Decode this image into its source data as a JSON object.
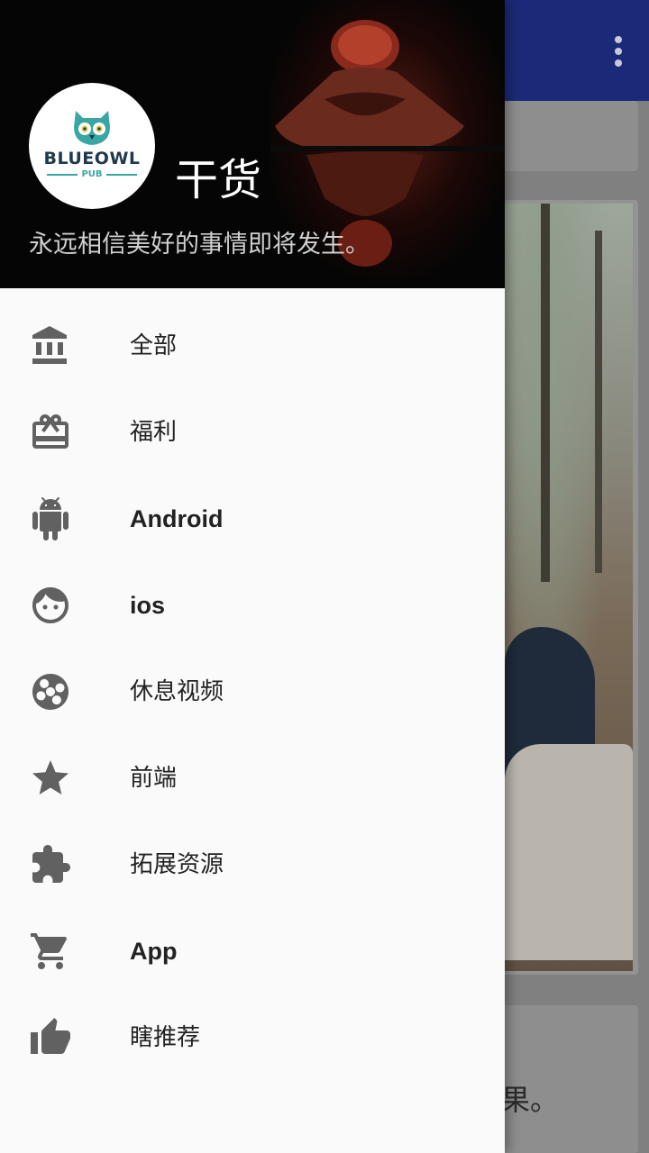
{
  "header": {
    "avatar_brand": "BLUEOWL",
    "avatar_sub": "PUB",
    "title": "干货",
    "subtitle": "永远相信美好的事情即将发生。"
  },
  "menu": {
    "items": [
      {
        "label": "全部",
        "icon": "bank-icon"
      },
      {
        "label": "福利",
        "icon": "gift-card-icon"
      },
      {
        "label": "Android",
        "icon": "android-icon"
      },
      {
        "label": "ios",
        "icon": "face-icon"
      },
      {
        "label": "休息视频",
        "icon": "film-reel-icon"
      },
      {
        "label": "前端",
        "icon": "star-icon"
      },
      {
        "label": "拓展资源",
        "icon": "extension-icon"
      },
      {
        "label": "App",
        "icon": "cart-icon"
      },
      {
        "label": "瞎推荐",
        "icon": "thumb-up-icon"
      }
    ]
  },
  "background": {
    "bottom_card_text": "果。"
  },
  "colors": {
    "toolbar": "#1b2a78",
    "drawer_bg": "#fafafa",
    "icon": "#616161",
    "accent": "#3aa6a4"
  }
}
